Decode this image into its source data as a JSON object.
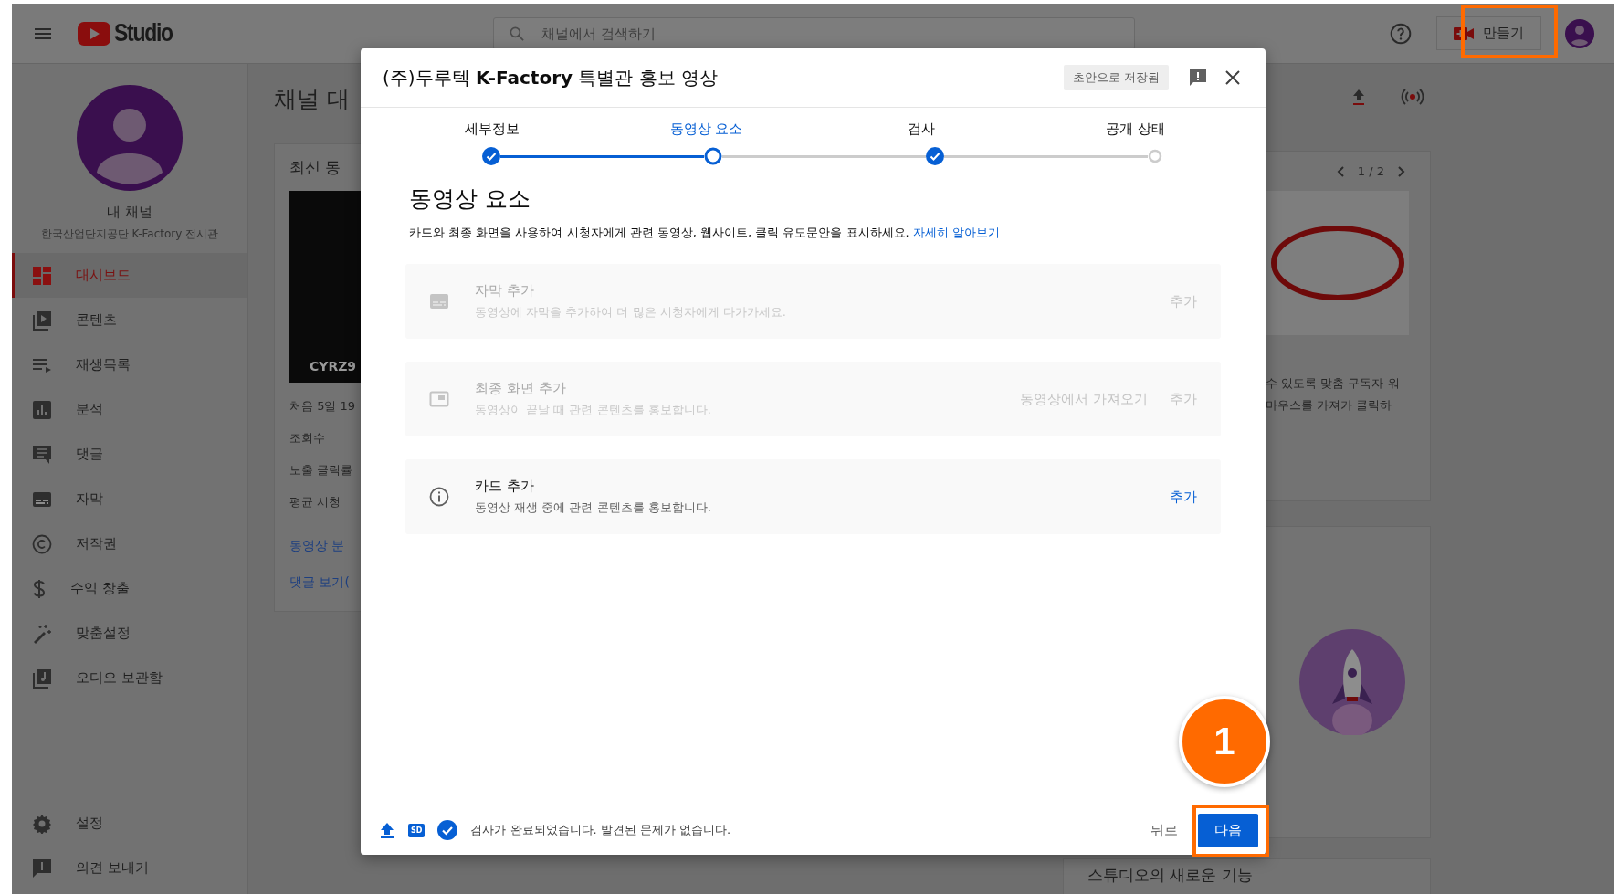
{
  "topbar": {
    "logo_text": "Studio",
    "search": {
      "placeholder": "채널에서 검색하기"
    },
    "create_button": "만들기"
  },
  "sidebar": {
    "channel_name": "내 채널",
    "channel_subtitle": "한국산업단지공단 K-Factory 전시관",
    "items": [
      {
        "label": "대시보드",
        "selected": true
      },
      {
        "label": "콘텐츠",
        "selected": false
      },
      {
        "label": "재생목록",
        "selected": false
      },
      {
        "label": "분석",
        "selected": false
      },
      {
        "label": "댓글",
        "selected": false
      },
      {
        "label": "자막",
        "selected": false
      },
      {
        "label": "저작권",
        "selected": false
      },
      {
        "label": "수익 창출",
        "selected": false
      },
      {
        "label": "맞춤설정",
        "selected": false
      },
      {
        "label": "오디오 보관함",
        "selected": false
      }
    ],
    "bottom_items": [
      {
        "label": "설정"
      },
      {
        "label": "의견 보내기"
      }
    ]
  },
  "background": {
    "page_title": "채널 대",
    "card_title": "최신 동",
    "video_caption": "CYRZ9",
    "stats": [
      "처음 5일 19",
      "조회수",
      "노출 클릭률",
      "평균 시청"
    ],
    "links": [
      "동영상 분",
      "댓글 보기("
    ],
    "pager": "1 / 2",
    "tip_lines": [
      "수 있도록 맞춤 구독자 워",
      "마우스를 가져가 클릭하"
    ],
    "bottom_title": "스튜디오의 새로운 기능"
  },
  "dialog": {
    "title": "(주)두루텍 **K-Factory** 특별관 홍보 영상",
    "status_chip": "초안으로 저장됨",
    "steps": [
      {
        "label": "세부정보",
        "completed": true,
        "selected": false
      },
      {
        "label": "동영상 요소",
        "completed": false,
        "selected": true
      },
      {
        "label": "검사",
        "completed": true,
        "selected": false
      },
      {
        "label": "공개 상태",
        "completed": false,
        "selected": false
      }
    ],
    "heading": "동영상 요소",
    "description": "카드와 최종 화면을 사용하여 시청자에게 관련 동영상, 웹사이트, 클릭 유도문안을 표시하세요.",
    "learn_more_link": "자세히 알아보기",
    "elements": [
      {
        "title": "자막 추가",
        "description": "동영상에 자막을 추가하여 더 많은 시청자에게 다가가세요.",
        "actions": [
          "추가"
        ],
        "disabled": true
      },
      {
        "title": "최종 화면 추가",
        "description": "동영상이 끝날 때 관련 콘텐츠를 홍보합니다.",
        "actions": [
          "동영상에서 가져오기",
          "추가"
        ],
        "disabled": true
      },
      {
        "title": "카드 추가",
        "description": "동영상 재생 중에 관련 콘텐츠를 홍보합니다.",
        "actions": [
          "추가"
        ],
        "disabled": false
      }
    ],
    "footer": {
      "sd_badge": "SD",
      "status_text": "검사가 완료되었습니다. 발견된 문제가 없습니다.",
      "back_button": "뒤로",
      "next_button": "다음"
    }
  },
  "annotation": {
    "step_number": "1"
  }
}
